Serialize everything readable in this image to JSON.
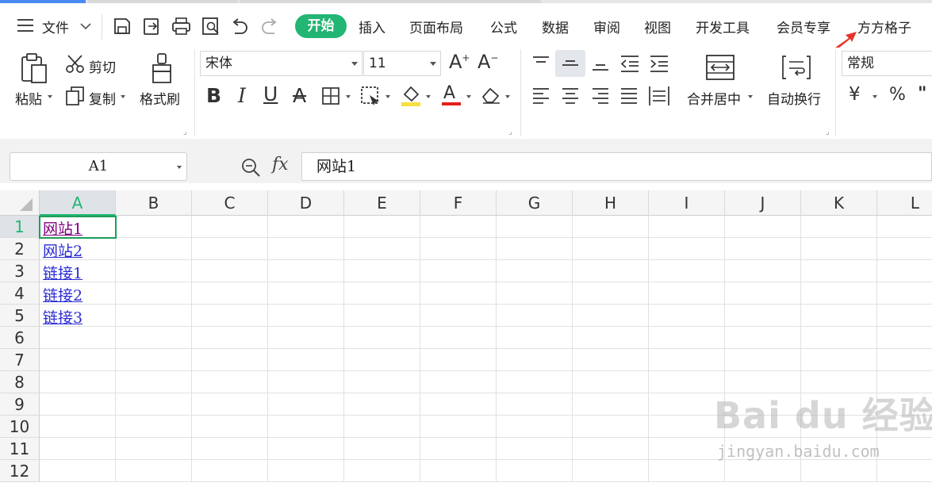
{
  "menubar": {
    "file_label": "文件",
    "tabs": [
      {
        "label": "开始",
        "active": true
      },
      {
        "label": "插入"
      },
      {
        "label": "页面布局"
      },
      {
        "label": "公式"
      },
      {
        "label": "数据"
      },
      {
        "label": "审阅"
      },
      {
        "label": "视图"
      },
      {
        "label": "开发工具"
      },
      {
        "label": "会员专享"
      },
      {
        "label": "方方格子"
      }
    ],
    "accent_color": "#22b573",
    "annotation_arrow_color": "#e8322b"
  },
  "ribbon": {
    "paste_label": "粘贴",
    "cut_label": "剪切",
    "copy_label": "复制",
    "format_painter_label": "格式刷",
    "font_name": "宋体",
    "font_size": "11",
    "merge_center_label": "合并居中",
    "wrap_text_label": "自动换行",
    "number_format": "常规",
    "currency_symbol": "¥",
    "percent_symbol": "%"
  },
  "formula_bar": {
    "name_box": "A1",
    "fx_label": "fx",
    "content": "网站1"
  },
  "sheet": {
    "columns": [
      "A",
      "B",
      "C",
      "D",
      "E",
      "F",
      "G",
      "H",
      "I",
      "J",
      "K",
      "L"
    ],
    "rows": [
      "1",
      "2",
      "3",
      "4",
      "5",
      "6",
      "7",
      "8",
      "9",
      "10",
      "11",
      "12"
    ],
    "cells": [
      {
        "ref": "A1",
        "text": "网站1",
        "visited": true
      },
      {
        "ref": "A2",
        "text": "网站2",
        "visited": false
      },
      {
        "ref": "A3",
        "text": "链接1",
        "visited": false
      },
      {
        "ref": "A4",
        "text": "链接2",
        "visited": false
      },
      {
        "ref": "A5",
        "text": "链接3",
        "visited": false
      }
    ],
    "link_color": "#2b2bd4",
    "visited_link_color": "#800080"
  },
  "watermark": {
    "brand": "Bai du 经验",
    "url": "jingyan.baidu.com"
  }
}
